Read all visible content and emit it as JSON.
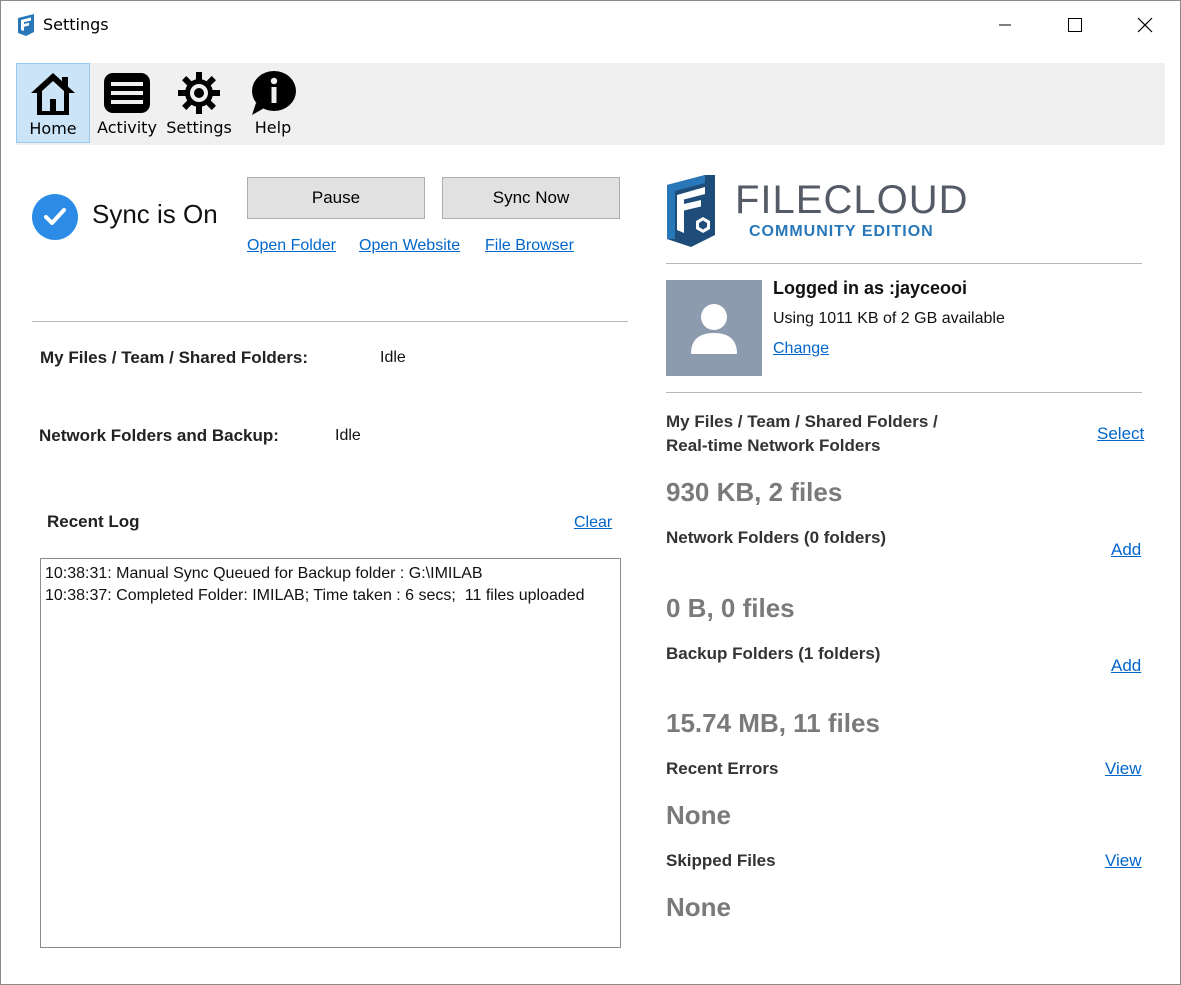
{
  "window": {
    "title": "Settings"
  },
  "toolbar": {
    "items": [
      {
        "label": "Home",
        "icon": "home-icon",
        "selected": true
      },
      {
        "label": "Activity",
        "icon": "list-icon",
        "selected": false
      },
      {
        "label": "Settings",
        "icon": "gear-icon",
        "selected": false
      },
      {
        "label": "Help",
        "icon": "info-bubble-icon",
        "selected": false
      }
    ]
  },
  "sync": {
    "status": "Sync is On",
    "pause_label": "Pause",
    "sync_now_label": "Sync Now",
    "links": {
      "open_folder": "Open Folder",
      "open_website": "Open Website",
      "file_browser": "File Browser"
    }
  },
  "status_rows": {
    "my_files_label": "My Files / Team / Shared Folders:",
    "my_files_value": "Idle",
    "network_label": "Network Folders and Backup:",
    "network_value": "Idle"
  },
  "recent_log": {
    "title": "Recent Log",
    "clear_label": "Clear",
    "lines": [
      "10:38:31: Manual Sync Queued for Backup folder : G:\\IMILAB",
      "10:38:37: Completed Folder: IMILAB; Time taken : 6 secs;  11 files uploaded"
    ]
  },
  "brand": {
    "name": "FILECLOUD",
    "edition": "COMMUNITY EDITION",
    "colors": {
      "primary": "#2877b9",
      "dark": "#1f4d7a",
      "text": "#555b66"
    }
  },
  "account": {
    "logged_in": "Logged in as :jayceooi",
    "usage": "Using 1011 KB of 2 GB available",
    "change_label": "Change"
  },
  "summary": {
    "my_files_line1": "My Files / Team / Shared Folders /",
    "my_files_line2": "Real-time Network Folders",
    "my_files_link": "Select",
    "my_files_value": "930 KB, 2 files",
    "network_label": "Network Folders (0 folders)",
    "network_link": "Add",
    "network_value": "0 B, 0 files",
    "backup_label": "Backup Folders (1 folders)",
    "backup_link": "Add",
    "backup_value": "15.74 MB, 11 files",
    "errors_label": "Recent Errors",
    "errors_link": "View",
    "errors_value": "None",
    "skipped_label": "Skipped Files",
    "skipped_link": "View",
    "skipped_value": "None"
  }
}
